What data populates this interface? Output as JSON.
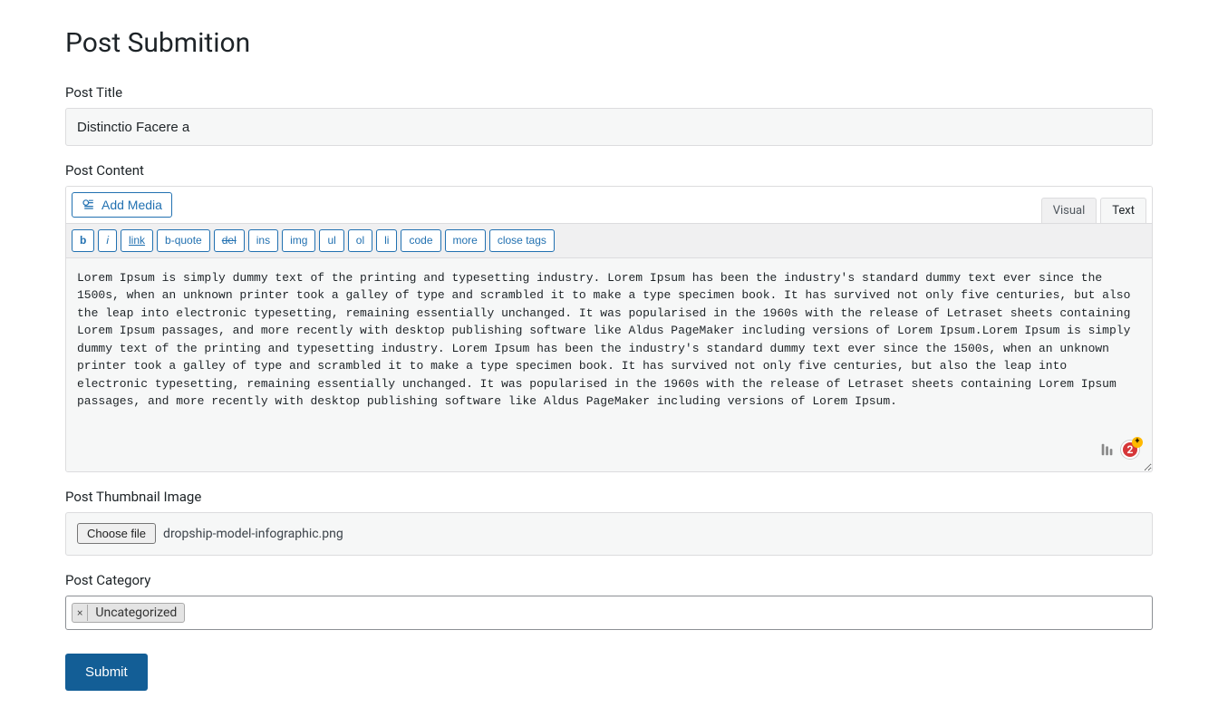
{
  "page_title": "Post Submition",
  "labels": {
    "post_title": "Post Title",
    "post_content": "Post Content",
    "post_thumbnail": "Post Thumbnail Image",
    "post_category": "Post Category"
  },
  "post_title_value": "Distinctio Facere a",
  "editor": {
    "add_media": "Add Media",
    "tab_visual": "Visual",
    "tab_text": "Text",
    "toolbar": {
      "b": "b",
      "i": "i",
      "link": "link",
      "bquote": "b-quote",
      "del": "del",
      "ins": "ins",
      "img": "img",
      "ul": "ul",
      "ol": "ol",
      "li": "li",
      "code": "code",
      "more": "more",
      "close_tags": "close tags"
    },
    "content": "Lorem Ipsum is simply dummy text of the printing and typesetting industry. Lorem Ipsum has been the industry's standard dummy text ever since the 1500s, when an unknown printer took a galley of type and scrambled it to make a type specimen book. It has survived not only five centuries, but also the leap into electronic typesetting, remaining essentially unchanged. It was popularised in the 1960s with the release of Letraset sheets containing Lorem Ipsum passages, and more recently with desktop publishing software like Aldus PageMaker including versions of Lorem Ipsum.Lorem Ipsum is simply dummy text of the printing and typesetting industry. Lorem Ipsum has been the industry's standard dummy text ever since the 1500s, when an unknown printer took a galley of type and scrambled it to make a type specimen book. It has survived not only five centuries, but also the leap into electronic typesetting, remaining essentially unchanged. It was popularised in the 1960s with the release of Letraset sheets containing Lorem Ipsum passages, and more recently with desktop publishing software like Aldus PageMaker including versions of Lorem Ipsum.",
    "badge_count": "2"
  },
  "file": {
    "choose_label": "Choose file",
    "filename": "dropship-model-infographic.png"
  },
  "category": {
    "chip_label": "Uncategorized",
    "chip_x": "×"
  },
  "submit_label": "Submit"
}
